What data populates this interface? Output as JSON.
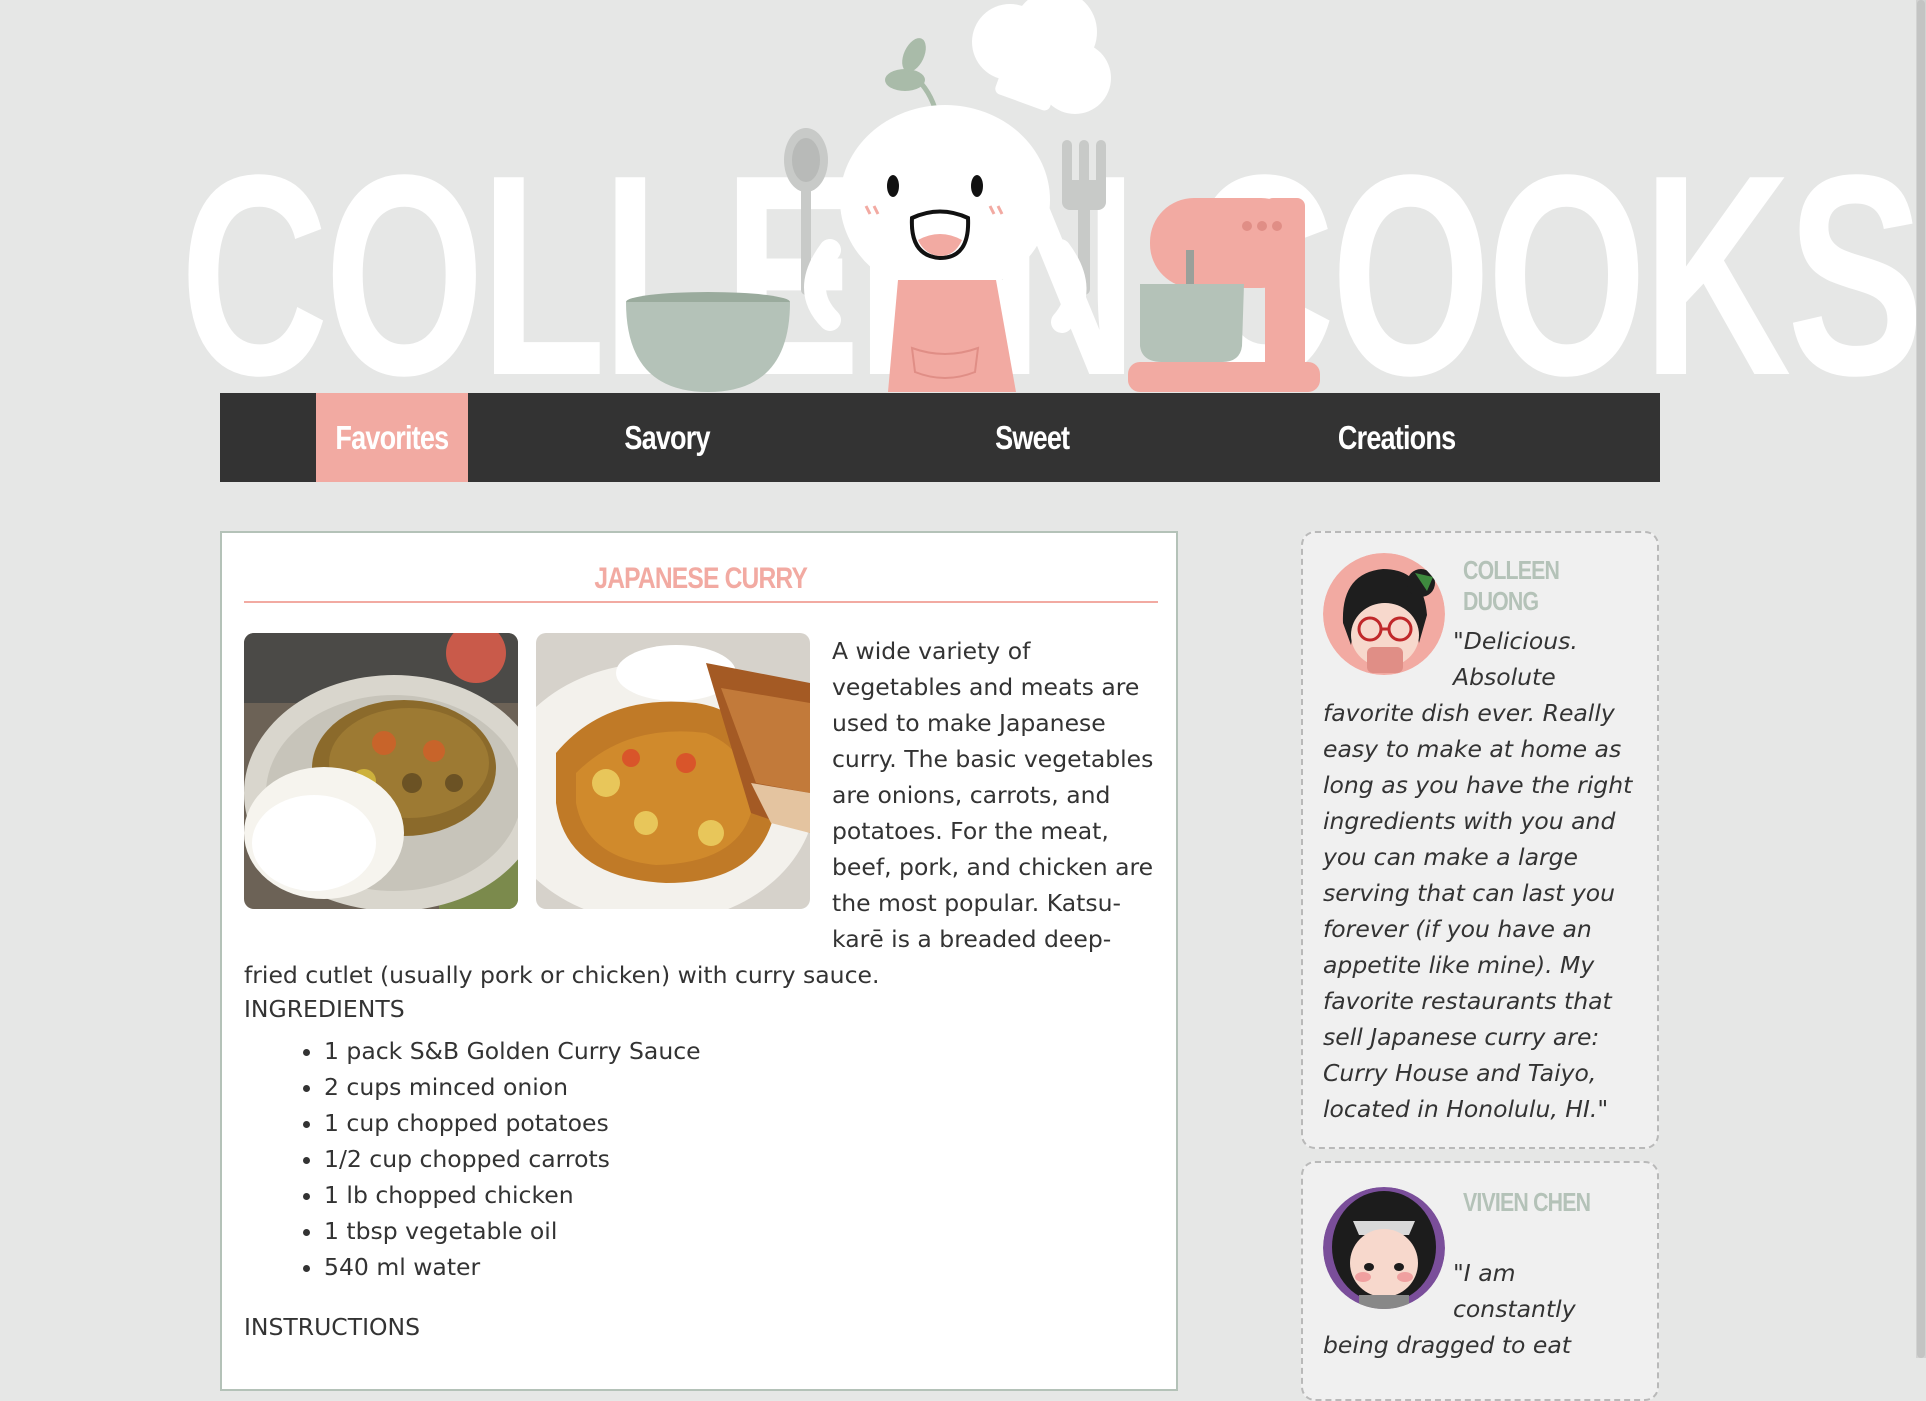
{
  "header": {
    "brand_title": "COLLEEN COOKS"
  },
  "nav": {
    "items": [
      {
        "label": "Favorites",
        "active": true
      },
      {
        "label": "Savory",
        "active": false
      },
      {
        "label": "Sweet",
        "active": false
      },
      {
        "label": "Creations",
        "active": false
      }
    ]
  },
  "recipe": {
    "title": "JAPANESE CURRY",
    "intro": "A wide variety of vegetables and meats are used to make Japanese curry. The basic vegetables are onions, carrots, and potatoes. For the meat, beef, pork, and chicken are the most popular. Katsu-karē is a breaded deep-fried cutlet (usually pork or chicken) with curry sauce.",
    "ingredients_label": "INGREDIENTS",
    "ingredients": [
      "1 pack S&B Golden Curry Sauce",
      "2 cups minced onion",
      "1 cup chopped potatoes",
      "1/2 cup chopped carrots",
      "1 lb chopped chicken",
      "1 tbsp vegetable oil",
      "540 ml water"
    ],
    "instructions_label": "INSTRUCTIONS"
  },
  "reviews": [
    {
      "name": "COLLEEN DUONG",
      "quote": "\"Delicious. Absolute favorite dish ever. Really easy to make at home as long as you have the right ingredients with you and you can make a large serving that can last you forever (if you have an appetite like mine). My favorite restaurants that sell Japanese curry are: Curry House and Taiyo, located in Honolulu, HI.\""
    },
    {
      "name": "VIVIEN CHEN",
      "quote": "\"I am constantly being dragged to eat"
    }
  ],
  "colors": {
    "accent_pink": "#f2aaa2",
    "sage": "#b4c2b8",
    "nav_bg": "#333333",
    "page_bg": "#e6e7e6"
  }
}
